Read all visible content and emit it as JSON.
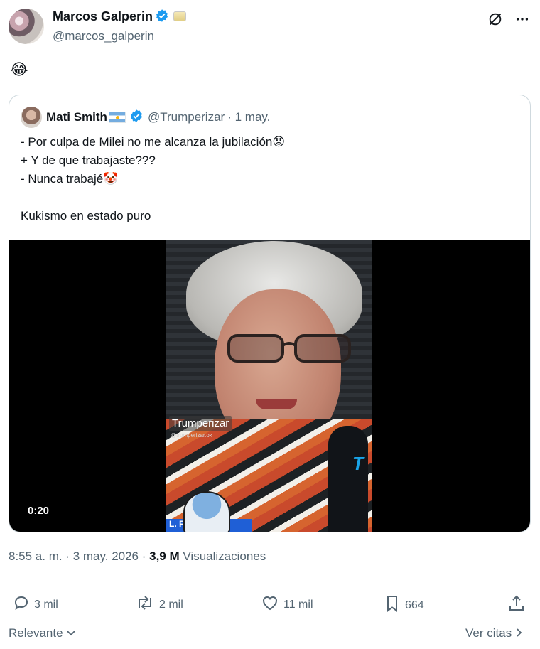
{
  "post": {
    "author_name": "Marcos Galperin",
    "author_handle": "@marcos_galperin",
    "text": "😂"
  },
  "icons": {
    "verified": "verified-badge-icon",
    "grok": "grok-icon",
    "more": "more-icon",
    "reply": "reply-icon",
    "repost": "repost-icon",
    "like": "like-icon",
    "bookmark": "bookmark-icon",
    "share": "share-icon"
  },
  "colors": {
    "verified": "#1d9bf0",
    "muted": "#536471",
    "text": "#0f1419",
    "border": "#cfd9de"
  },
  "quote": {
    "author_name": "Mati Smith",
    "author_handle": "@Trumperizar",
    "date": "· 1 may.",
    "text": "- Por culpa de Milei no me alcanza la jubilación😡\n+ Y de que trabajaste???\n- Nunca trabajé🤡\n\nKukismo en estado puro",
    "video": {
      "duration": "0:20",
      "watermark": "Trumperizar",
      "watermark_sub": "@trumperizar.ok",
      "caption_fragment": "L. F... O\"",
      "mic_logo": "T"
    }
  },
  "meta": {
    "time": "8:55 a. m.",
    "sep1": " · ",
    "date": "3 may. 2026",
    "sep2": " · ",
    "views_count": "3,9 M",
    "views_label": " Visualizaciones"
  },
  "actions": {
    "replies": "3 mil",
    "reposts": "2 mil",
    "likes": "11 mil",
    "bookmarks": "664"
  },
  "footer": {
    "sort": "Relevante",
    "quotes": "Ver citas"
  }
}
